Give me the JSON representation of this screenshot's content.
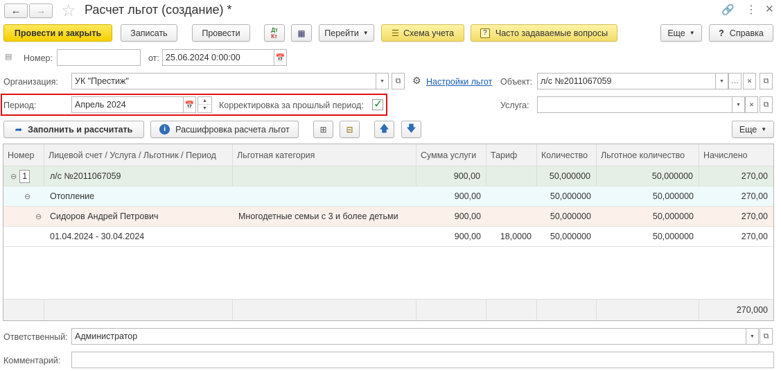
{
  "window": {
    "title": "Расчет льгот (создание) *"
  },
  "toolbar": {
    "post_close": "Провести и закрыть",
    "save": "Записать",
    "post": "Провести",
    "dt_kt_top": "Дт",
    "dt_kt_bottom": "Кт",
    "goto": "Перейти",
    "scheme": "Схема учета",
    "faq": "Часто задаваемые вопросы",
    "more": "Еще",
    "help": "Справка"
  },
  "form": {
    "number_label": "Номер:",
    "number_value": "",
    "from_label": "от:",
    "date_value": "25.06.2024  0:00:00",
    "org_label": "Организация:",
    "org_value": "УК \"Престиж\"",
    "settings_link": "Настройки льгот",
    "object_label": "Объект:",
    "object_value": "л/с №2011067059",
    "period_label": "Период:",
    "period_value": "Апрель 2024",
    "correction_label": "Корректировка за прошлый период:",
    "service_label": "Услуга:",
    "service_value": ""
  },
  "table_toolbar": {
    "fill": "Заполнить и рассчитать",
    "decode": "Расшифровка расчета льгот",
    "more": "Еще"
  },
  "table": {
    "headers": [
      "Номер",
      "Лицевой счет / Услуга / Льготник / Период",
      "Льготная категория",
      "Сумма услуги",
      "Тариф",
      "Количество",
      "Льготное количество",
      "Начислено"
    ],
    "rows": [
      {
        "num": "1",
        "name": "л/с №2011067059",
        "category": "",
        "sum": "900,00",
        "tariff": "",
        "qty": "50,000000",
        "lqty": "50,000000",
        "accrued": "270,00"
      },
      {
        "num": "",
        "name": "Отопление",
        "category": "",
        "sum": "900,00",
        "tariff": "",
        "qty": "50,000000",
        "lqty": "50,000000",
        "accrued": "270,00"
      },
      {
        "num": "",
        "name": "Сидоров Андрей Петрович",
        "category": "Многодетные семьи с 3 и более детьми",
        "sum": "900,00",
        "tariff": "",
        "qty": "50,000000",
        "lqty": "50,000000",
        "accrued": "270,00"
      },
      {
        "num": "",
        "name": "01.04.2024 - 30.04.2024",
        "category": "",
        "sum": "900,00",
        "tariff": "18,0000",
        "qty": "50,000000",
        "lqty": "50,000000",
        "accrued": "270,00"
      }
    ],
    "total": "270,000"
  },
  "footer": {
    "responsible_label": "Ответственный:",
    "responsible_value": "Администратор",
    "comment_label": "Комментарий:",
    "comment_value": ""
  },
  "colors": {
    "row_level1": "#e6efe6",
    "row_level2": "#eefafb",
    "row_level3": "#fbf0ea",
    "highlight_border": "#e01010",
    "link": "#1a5fb4",
    "check": "#1f8f3a"
  }
}
